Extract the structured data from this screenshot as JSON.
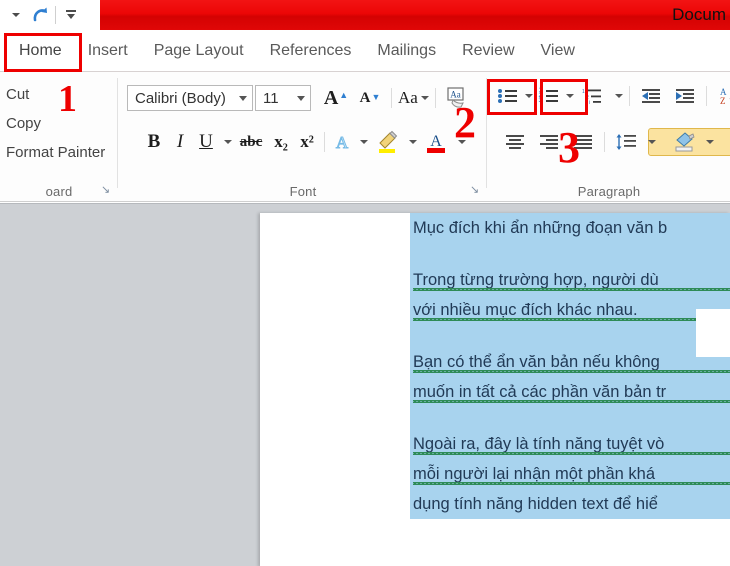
{
  "window": {
    "title": "Docum",
    "accent_red": "#ee0000",
    "titlebar_color": "#ec0606"
  },
  "quick_access": {
    "items": [
      {
        "name": "customize-arrow",
        "label": "▾"
      },
      {
        "name": "redo-icon",
        "label": "↷"
      },
      {
        "name": "overflow-arrow",
        "label": "▾"
      }
    ]
  },
  "tabs": [
    {
      "label": "Home",
      "active": true
    },
    {
      "label": "Insert",
      "active": false
    },
    {
      "label": "Page Layout",
      "active": false
    },
    {
      "label": "References",
      "active": false
    },
    {
      "label": "Mailings",
      "active": false
    },
    {
      "label": "Review",
      "active": false
    },
    {
      "label": "View",
      "active": false
    }
  ],
  "annotations": [
    {
      "number": "1",
      "target": "clipboard-group",
      "color": "#ee0000"
    },
    {
      "number": "2",
      "target": "bullets-button",
      "color": "#ee0000"
    },
    {
      "number": "3",
      "target": "numbering-button",
      "color": "#ee0000"
    }
  ],
  "ribbon": {
    "clipboard": {
      "label": "oard",
      "full_label": "Clipboard",
      "items": [
        {
          "label": "Cut"
        },
        {
          "label": "Copy"
        },
        {
          "label": "Format Painter"
        }
      ],
      "launcher": "↘"
    },
    "font": {
      "label": "Font",
      "font_name": "Calibri (Body)",
      "font_size": "11",
      "launcher": "↘",
      "buttons_row1": [
        {
          "name": "grow-font-button",
          "glyph": "A▴"
        },
        {
          "name": "shrink-font-button",
          "glyph": "A▾"
        },
        {
          "name": "change-case-button",
          "glyph": "Aa"
        },
        {
          "name": "clear-formatting-button",
          "glyph": "Aa"
        }
      ],
      "buttons_row2": [
        {
          "name": "bold-button",
          "glyph": "B"
        },
        {
          "name": "italic-button",
          "glyph": "I"
        },
        {
          "name": "underline-button",
          "glyph": "U"
        },
        {
          "name": "strikethrough-button",
          "glyph": "abc"
        },
        {
          "name": "subscript-button",
          "glyph": "x₂"
        },
        {
          "name": "superscript-button",
          "glyph": "x²"
        },
        {
          "name": "text-effects-button",
          "glyph": "A"
        },
        {
          "name": "text-highlight-button",
          "glyph": "✎"
        },
        {
          "name": "font-color-button",
          "glyph": "A"
        }
      ]
    },
    "paragraph": {
      "label": "Paragraph",
      "buttons_row1": [
        {
          "name": "bullets-button",
          "glyph": "bullet-list-icon",
          "boxed": true
        },
        {
          "name": "numbering-button",
          "glyph": "numbered-list-icon",
          "boxed": true
        },
        {
          "name": "multilevel-list-button",
          "glyph": "multilevel-list-icon"
        },
        {
          "name": "decrease-indent-button",
          "glyph": "decrease-indent-icon"
        },
        {
          "name": "increase-indent-button",
          "glyph": "increase-indent-icon"
        },
        {
          "name": "sort-button",
          "glyph": "AZ"
        }
      ],
      "buttons_row2": [
        {
          "name": "align-left-button",
          "selected": true
        },
        {
          "name": "align-center-button",
          "selected": false
        },
        {
          "name": "align-right-button",
          "selected": false
        },
        {
          "name": "justify-button",
          "selected": false
        },
        {
          "name": "line-spacing-button",
          "selected": false
        },
        {
          "name": "shading-button",
          "selected": false
        }
      ]
    }
  },
  "document": {
    "selection_color": "#a8d3ee",
    "text_color": "#213a56",
    "paragraphs": [
      {
        "lines": [
          {
            "text": "Mục đích khi ẩn những đoạn văn b",
            "squiggly": false
          }
        ]
      },
      {
        "lines": [
          {
            "text": "Trong từng trường hợp, người dù",
            "squiggly": true
          },
          {
            "text": "với nhiều mục đích khác nhau.",
            "squiggly": true
          }
        ]
      },
      {
        "lines": [
          {
            "text": "Bạn có thể ẩn văn bản nếu không",
            "squiggly": true
          },
          {
            "text": "muốn in tất cả các phần văn bản tr",
            "squiggly": true
          }
        ]
      },
      {
        "lines": [
          {
            "text": "Ngoài ra, đây là tính năng tuyệt vò",
            "squiggly": true
          },
          {
            "text": "mỗi người lại nhận một phần khá",
            "squiggly": true
          },
          {
            "text": "dụng tính năng hidden text để hiể",
            "squiggly": false
          }
        ]
      }
    ]
  }
}
